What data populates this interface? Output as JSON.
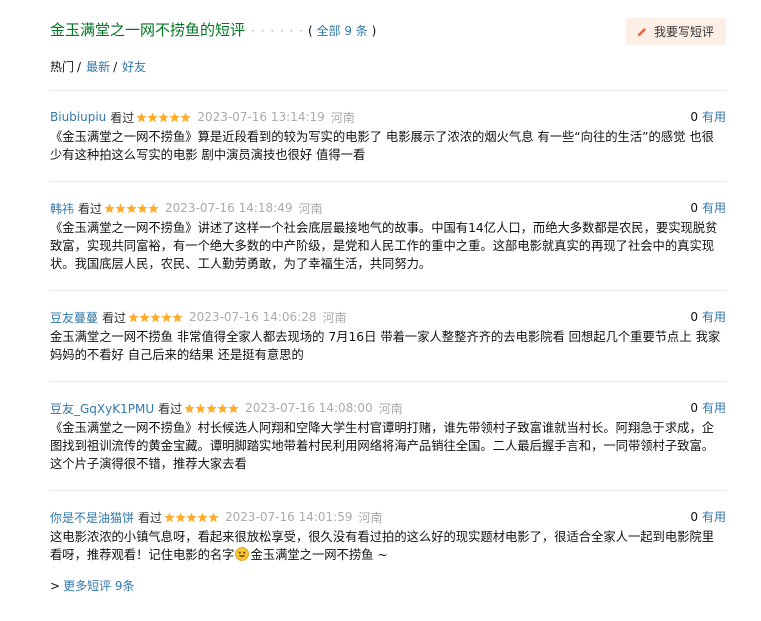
{
  "header": {
    "title": "金玉满堂之一网不捞鱼的短评",
    "dots": "· · · · · ·",
    "count_open": "(",
    "count_label": "全部 9 条",
    "count_close": ")",
    "write_button": "我要写短评"
  },
  "tabs": [
    {
      "label": "热门",
      "sep": "/"
    },
    {
      "label": "最新",
      "sep": "/"
    },
    {
      "label": "好友",
      "sep": ""
    }
  ],
  "comments": [
    {
      "author": "Biubiupiu",
      "status": "看过",
      "rating": 5,
      "time": "2023-07-16 13:14:19",
      "location": "河南",
      "votes": "0",
      "useful": "有用",
      "text": "《金玉满堂之一网不捞鱼》算是近段看到的较为写实的电影了 电影展示了浓浓的烟火气息 有一些“向往的生活”的感觉 也很少有这种拍这么写实的电影 剧中演员演技也很好 值得一看"
    },
    {
      "author": "韩祎",
      "status": "看过",
      "rating": 5,
      "time": "2023-07-16 14:18:49",
      "location": "河南",
      "votes": "0",
      "useful": "有用",
      "text": "《金玉满堂之一网不捞鱼》讲述了这样一个社会底层最接地气的故事。中国有14亿人口，而绝大多数都是农民，要实现脱贫致富，实现共同富裕，有一个绝大多数的中产阶级，是党和人民工作的重中之重。这部电影就真实的再现了社会中的真实现状。我国底层人民，农民、工人勤劳勇敢，为了幸福生活，共同努力。"
    },
    {
      "author": "豆友蔓蔓",
      "status": "看过",
      "rating": 5,
      "time": "2023-07-16 14:06:28",
      "location": "河南",
      "votes": "0",
      "useful": "有用",
      "text": "金玉满堂之一网不捞鱼 非常值得全家人都去现场的 7月16日 带着一家人整整齐齐的去电影院看 回想起几个重要节点上 我家妈妈的不看好 自己后来的结果 还是挺有意思的"
    },
    {
      "author": "豆友_GqXyK1PMU",
      "status": "看过",
      "rating": 5,
      "time": "2023-07-16 14:08:00",
      "location": "河南",
      "votes": "0",
      "useful": "有用",
      "text": "《金玉满堂之一网不捞鱼》村长候选人阿翔和空降大学生村官谭明打赌，谁先带领村子致富谁就当村长。阿翔急于求成，企图找到祖训流传的黄金宝藏。谭明脚踏实地带着村民利用网络将海产品销往全国。二人最后握手言和，一同带领村子致富。这个片子演得很不错，推荐大家去看"
    },
    {
      "author": "你是不是油猫饼",
      "status": "看过",
      "rating": 5,
      "time": "2023-07-16 14:01:59",
      "location": "河南",
      "votes": "0",
      "useful": "有用",
      "text_before_emoji": "这电影浓浓的小镇气息呀，看起来很放松享受，很久没有看过拍的这么好的现实题材电影了，很适合全家人一起到电影院里看呀，推荐观看！记住电影的名字",
      "emoji_icon": "smiley-emoji-icon",
      "text_after_emoji": "金玉满堂之一网不捞鱼 ~"
    }
  ],
  "more": {
    "arrow": ">",
    "label": "更多短评 9条"
  },
  "colors": {
    "title_green": "#007722",
    "link_blue": "#3377aa",
    "meta_gray": "#aaaaaa",
    "star_orange": "#ffac2d",
    "button_bg": "#fdeee6"
  }
}
